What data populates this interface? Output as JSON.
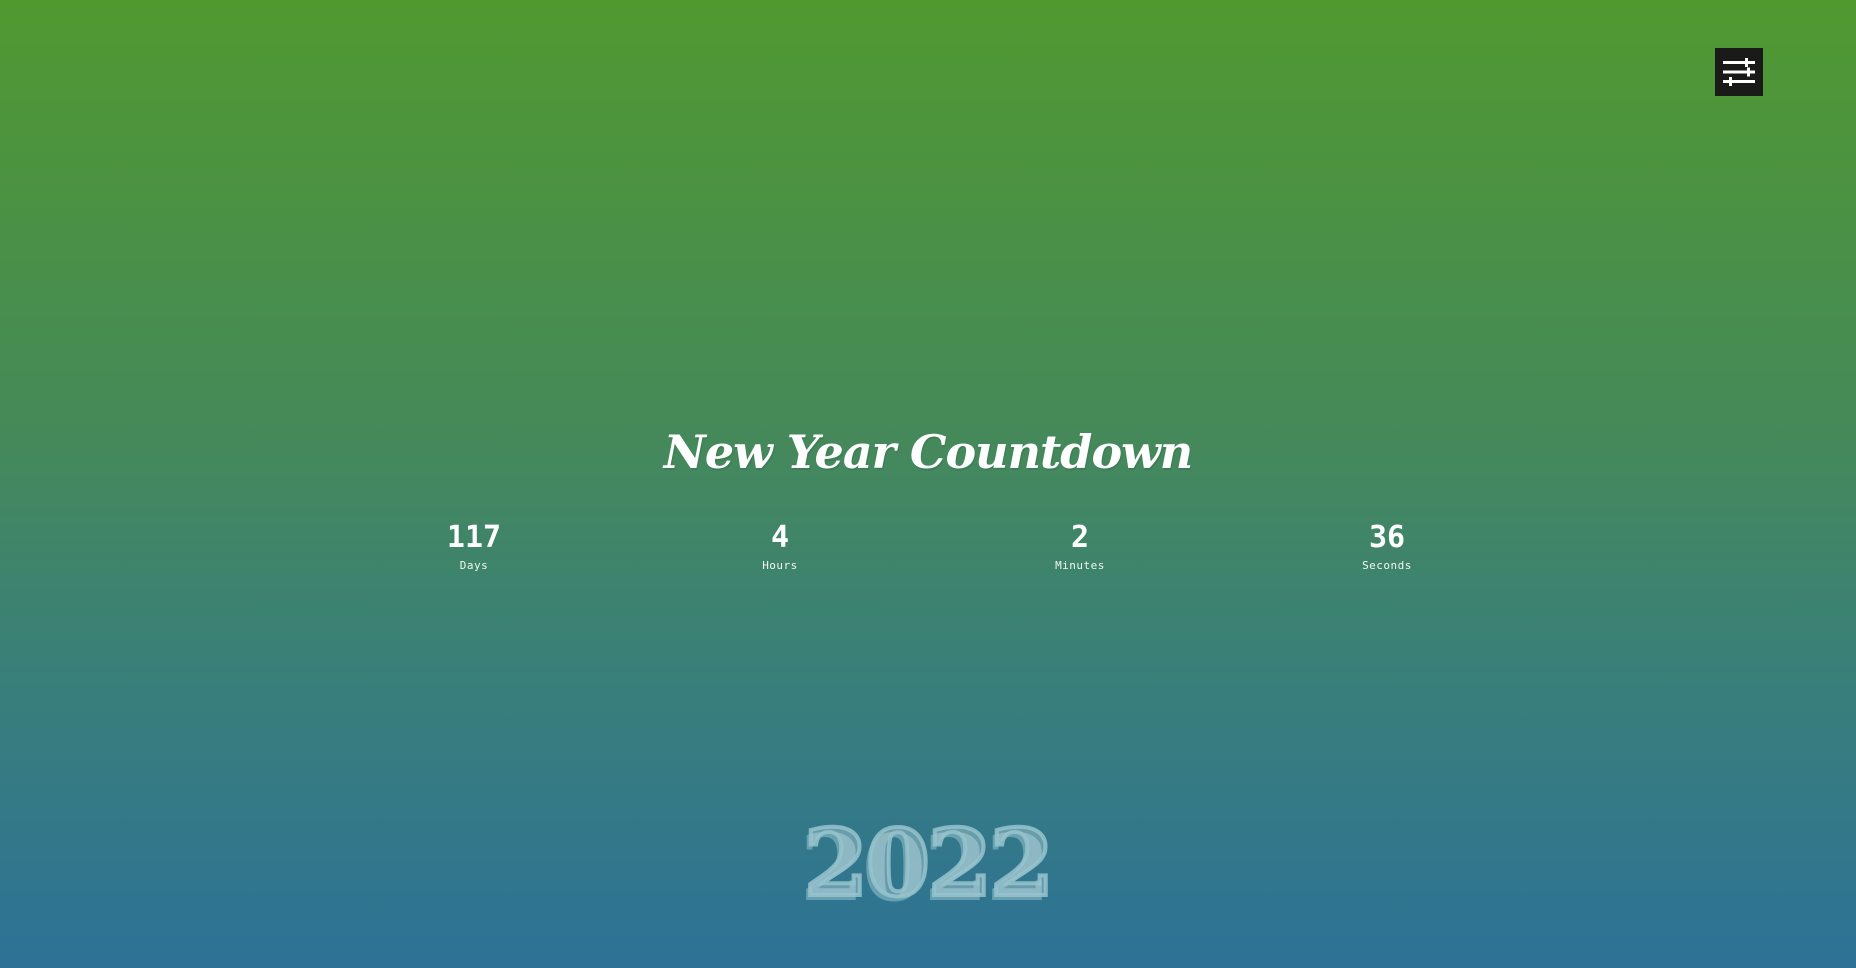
{
  "title": "New Year Countdown",
  "countdown": {
    "days": {
      "value": "117",
      "label": "Days"
    },
    "hours": {
      "value": "4",
      "label": "Hours"
    },
    "minutes": {
      "value": "2",
      "label": "Minutes"
    },
    "seconds": {
      "value": "36",
      "label": "Seconds"
    }
  },
  "year": "2022",
  "settings": {
    "icon": "sliders-icon"
  },
  "colors": {
    "gradient_top": "#509930",
    "gradient_bottom": "#2d7296",
    "settings_button_bg": "#1a1a18",
    "text": "#ffffff"
  }
}
